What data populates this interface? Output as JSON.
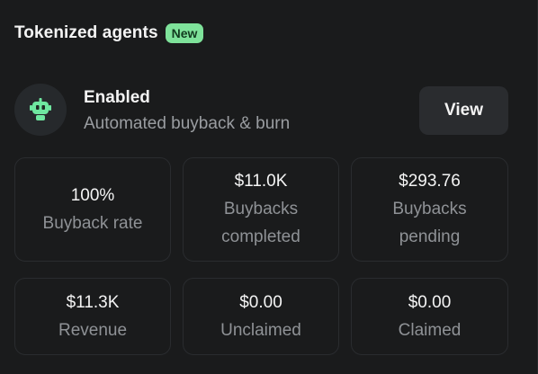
{
  "header": {
    "title": "Tokenized agents",
    "badge": "New"
  },
  "agent": {
    "avatar_icon": "robot-icon",
    "status": "Enabled",
    "description": "Automated buyback & burn",
    "view_label": "View"
  },
  "stats": [
    {
      "value": "100%",
      "label": "Buyback rate"
    },
    {
      "value": "$11.0K",
      "label_line1": "Buybacks",
      "label_line2": "completed"
    },
    {
      "value": "$293.76",
      "label_line1": "Buybacks",
      "label_line2": "pending"
    },
    {
      "value": "$11.3K",
      "label": "Revenue"
    },
    {
      "value": "$0.00",
      "label": "Unclaimed"
    },
    {
      "value": "$0.00",
      "label": "Claimed"
    }
  ],
  "colors": {
    "background": "#1a1b1c",
    "badge": "#7ee29a",
    "robot": "#6ee7a0"
  }
}
